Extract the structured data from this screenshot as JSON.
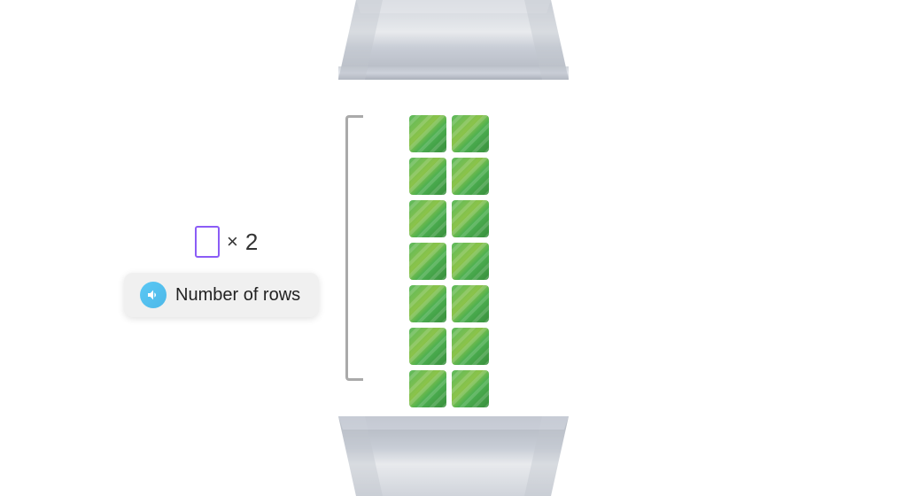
{
  "tooltip": {
    "label": "Number of rows"
  },
  "symbol": {
    "multiply": "×",
    "count": "2"
  },
  "grid": {
    "columns": 2,
    "rows": 7,
    "cell_color_start": "#6abf69",
    "cell_color_end": "#388e3c"
  }
}
